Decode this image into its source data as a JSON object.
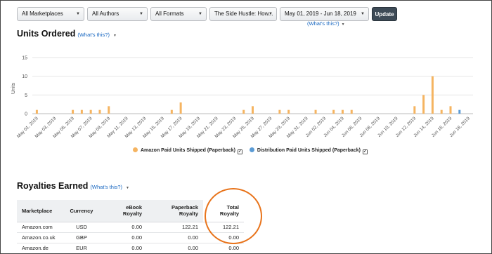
{
  "filters": {
    "marketplace": "All Marketplaces",
    "authors": "All Authors",
    "formats": "All Formats",
    "title": "The Side Hustle: How...",
    "date_range": "May 01, 2019 - Jun 18, 2019",
    "update_label": "Update",
    "whats_this": "(What's this?)"
  },
  "units_section": {
    "title": "Units Ordered",
    "whats_this": "(What's this?)"
  },
  "royalties_section": {
    "title": "Royalties Earned",
    "whats_this": "(What's this?)"
  },
  "chart_data": {
    "type": "bar",
    "title": "",
    "xlabel": "",
    "ylabel": "Units",
    "ylim": [
      0,
      15
    ],
    "yticks": [
      0,
      5,
      10,
      15
    ],
    "grid": true,
    "legend_position": "bottom",
    "tick_labels": [
      "May 01, 2019",
      "May 03, 2019",
      "May 05, 2019",
      "May 07, 2019",
      "May 09, 2019",
      "May 11, 2019",
      "May 13, 2019",
      "May 15, 2019",
      "May 17, 2019",
      "May 19, 2019",
      "May 21, 2019",
      "May 23, 2019",
      "May 25, 2019",
      "May 27, 2019",
      "May 29, 2019",
      "May 31, 2019",
      "Jun 02, 2019",
      "Jun 04, 2019",
      "Jun 06, 2019",
      "Jun 08, 2019",
      "Jun 10, 2019",
      "Jun 12, 2019",
      "Jun 14, 2019",
      "Jun 16, 2019",
      "Jun 18, 2019"
    ],
    "categories": [
      "May 01",
      "May 02",
      "May 03",
      "May 04",
      "May 05",
      "May 06",
      "May 07",
      "May 08",
      "May 09",
      "May 10",
      "May 11",
      "May 12",
      "May 13",
      "May 14",
      "May 15",
      "May 16",
      "May 17",
      "May 18",
      "May 19",
      "May 20",
      "May 21",
      "May 22",
      "May 23",
      "May 24",
      "May 25",
      "May 26",
      "May 27",
      "May 28",
      "May 29",
      "May 30",
      "May 31",
      "Jun 01",
      "Jun 02",
      "Jun 03",
      "Jun 04",
      "Jun 05",
      "Jun 06",
      "Jun 07",
      "Jun 08",
      "Jun 09",
      "Jun 10",
      "Jun 11",
      "Jun 12",
      "Jun 13",
      "Jun 14",
      "Jun 15",
      "Jun 16",
      "Jun 17",
      "Jun 18"
    ],
    "series": [
      {
        "name": "Amazon Paid Units Shipped (Paperback)",
        "color": "#f5b461",
        "values": [
          1,
          0,
          0,
          0,
          1,
          1,
          1,
          1,
          2,
          0,
          0,
          0,
          0,
          0,
          0,
          1,
          3,
          0,
          0,
          0,
          0,
          0,
          0,
          1,
          2,
          0,
          0,
          1,
          1,
          0,
          0,
          1,
          0,
          1,
          1,
          1,
          0,
          0,
          0,
          0,
          0,
          0,
          2,
          5,
          10,
          1,
          2,
          0,
          0
        ]
      },
      {
        "name": "Distribution Paid Units Shipped (Paperback)",
        "color": "#5b9bd5",
        "values": [
          0,
          0,
          0,
          0,
          0,
          0,
          0,
          0,
          0,
          0,
          0,
          0,
          0,
          0,
          0,
          0,
          0,
          0,
          0,
          0,
          0,
          0,
          0,
          0,
          0,
          0,
          0,
          0,
          0,
          0,
          0,
          0,
          0,
          0,
          0,
          0,
          0,
          0,
          0,
          0,
          0,
          0,
          0,
          0,
          0,
          0,
          0,
          1,
          0
        ]
      }
    ]
  },
  "royalties_table": {
    "headers": [
      [
        "Marketplace"
      ],
      [
        "Currency"
      ],
      [
        "eBook",
        "Royalty"
      ],
      [
        "Paperback",
        "Royalty"
      ],
      [
        "Total",
        "Royalty"
      ]
    ],
    "rows": [
      [
        "Amazon.com",
        "USD",
        "0.00",
        "122.21",
        "122.21"
      ],
      [
        "Amazon.co.uk",
        "GBP",
        "0.00",
        "0.00",
        "0.00"
      ],
      [
        "Amazon.de",
        "EUR",
        "0.00",
        "0.00",
        "0.00"
      ]
    ]
  },
  "colors": {
    "accent_circle": "#e8731a",
    "link": "#1565c0",
    "update_button": "#3d4a56"
  }
}
